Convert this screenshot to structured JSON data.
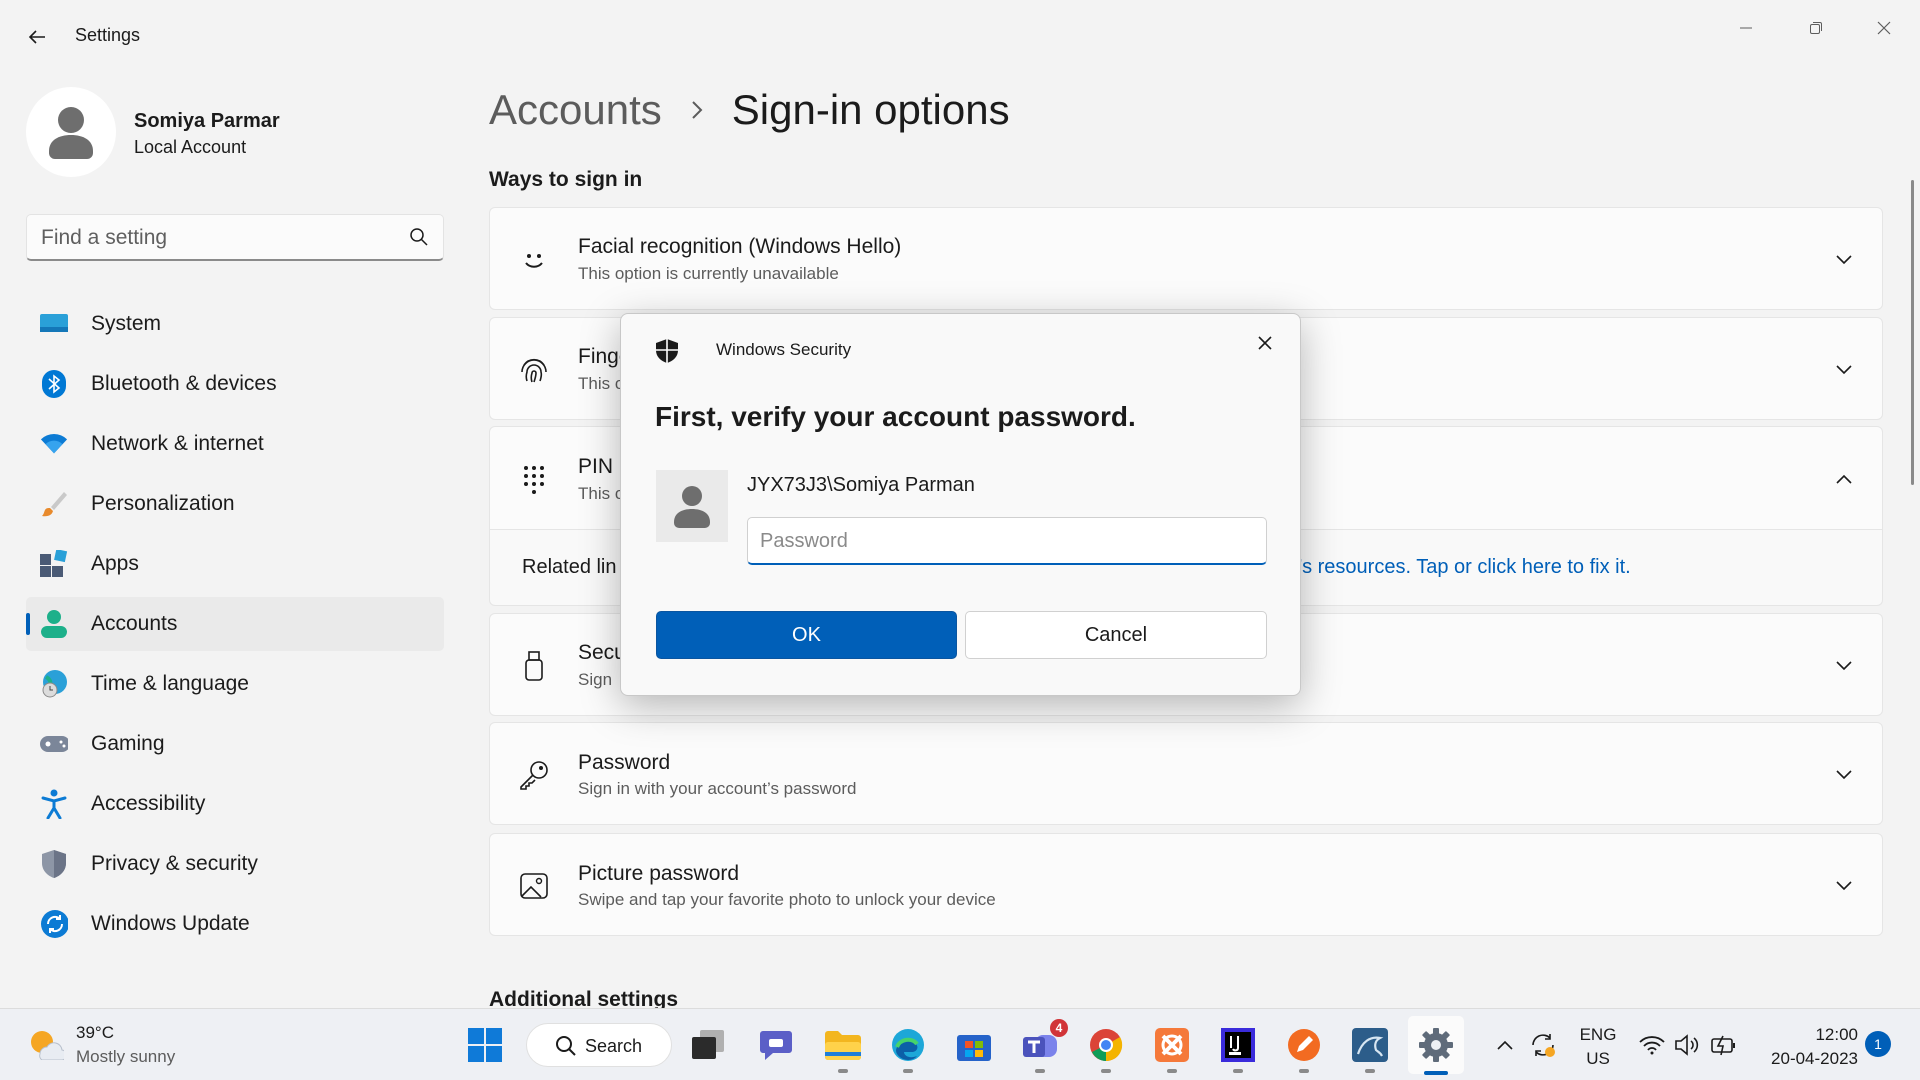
{
  "window": {
    "title": "Settings"
  },
  "profile": {
    "name": "Somiya Parmar",
    "account_type": "Local Account"
  },
  "search": {
    "placeholder": "Find a setting"
  },
  "sidebar": {
    "items": [
      {
        "label": "System",
        "icon": "system-icon"
      },
      {
        "label": "Bluetooth & devices",
        "icon": "bluetooth-icon"
      },
      {
        "label": "Network & internet",
        "icon": "wifi-icon"
      },
      {
        "label": "Personalization",
        "icon": "brush-icon"
      },
      {
        "label": "Apps",
        "icon": "apps-icon"
      },
      {
        "label": "Accounts",
        "icon": "accounts-icon",
        "active": true
      },
      {
        "label": "Time & language",
        "icon": "globe-clock-icon"
      },
      {
        "label": "Gaming",
        "icon": "gamepad-icon"
      },
      {
        "label": "Accessibility",
        "icon": "accessibility-icon"
      },
      {
        "label": "Privacy & security",
        "icon": "shield-icon"
      },
      {
        "label": "Windows Update",
        "icon": "update-icon"
      }
    ]
  },
  "breadcrumb": {
    "parent": "Accounts",
    "current": "Sign-in options"
  },
  "main": {
    "section_title": "Ways to sign in",
    "cards": [
      {
        "title": "Facial recognition (Windows Hello)",
        "subtitle": "This option is currently unavailable"
      },
      {
        "title": "Finge",
        "subtitle": "This c"
      },
      {
        "title": "PIN (",
        "subtitle": "This c"
      },
      {
        "title": "Secu",
        "subtitle": "Sign"
      },
      {
        "title": "Password",
        "subtitle": "Sign in with your account’s password"
      },
      {
        "title": "Picture password",
        "subtitle": "Swipe and tap your favorite photo to unlock your device"
      }
    ],
    "related_label": "Related lin",
    "related_link": "’s resources. Tap or click here to fix it.",
    "additional_title": "Additional settings"
  },
  "dialog": {
    "title": "Windows Security",
    "heading": "First, verify your account password.",
    "user": "JYX73J3\\Somiya Parman",
    "password_placeholder": "Password",
    "ok_label": "OK",
    "cancel_label": "Cancel"
  },
  "taskbar": {
    "weather_temp": "39°C",
    "weather_desc": "Mostly sunny",
    "search_label": "Search",
    "teams_badge": "4",
    "lang_line1": "ENG",
    "lang_line2": "US",
    "time": "12:00",
    "date": "20-04-2023",
    "notification_count": "1"
  },
  "colors": {
    "accent": "#005fb8",
    "background": "#f3f3f3",
    "card": "#fbfbfb"
  }
}
